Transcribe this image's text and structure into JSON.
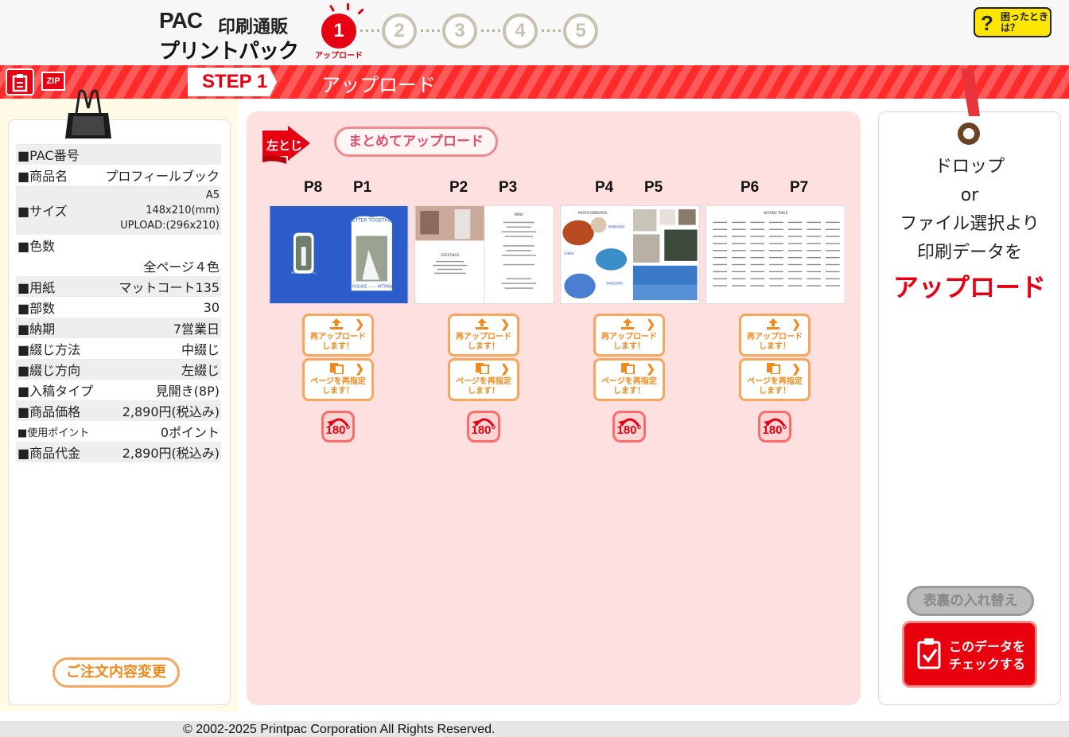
{
  "header": {
    "logo": {
      "pac": "PAC",
      "sub": "印刷通販",
      "main": "プリントパック"
    },
    "steps": [
      "1",
      "2",
      "3",
      "4",
      "5"
    ],
    "active_step_caption": "アップロード",
    "help_label": "困ったときは？",
    "help_mark": "?"
  },
  "banner": {
    "zip_label": "ZIP",
    "step_label": "STEP 1",
    "title": "アップロード"
  },
  "specs": {
    "rows": [
      {
        "label": "■PAC番号",
        "value": ""
      },
      {
        "label": "■商品名",
        "value": "プロフィールブック"
      },
      {
        "label": "■サイズ",
        "value_lines": [
          "A5",
          "148x210(mm)",
          "UPLOAD:(296x210)"
        ]
      },
      {
        "label": "■色数",
        "value": ""
      },
      {
        "label": "",
        "value": "全ページ４色"
      },
      {
        "label": "■用紙",
        "value": "マットコート135"
      },
      {
        "label": "■部数",
        "value": "30"
      },
      {
        "label": "■納期",
        "value": "7営業日"
      },
      {
        "label": "■綴じ方法",
        "value": "中綴じ"
      },
      {
        "label": "■綴じ方向",
        "value": "左綴じ"
      },
      {
        "label": "■入稿タイプ",
        "value": "見開き(8P)"
      },
      {
        "label": "■商品価格",
        "value": "2,890円(税込み)"
      },
      {
        "label": "■使用ポイント",
        "value": "0ポイント"
      },
      {
        "label": "■商品代金",
        "value": "2,890円(税込み)"
      }
    ],
    "change_order_label": "ご注文内容変更"
  },
  "center": {
    "binding_label": "左とじ",
    "bulk_upload_label": "まとめてアップロード",
    "spreads": [
      {
        "left_page": "P8",
        "right_page": "P1"
      },
      {
        "left_page": "P2",
        "right_page": "P3"
      },
      {
        "left_page": "P4",
        "right_page": "P5"
      },
      {
        "left_page": "P6",
        "right_page": "P7"
      }
    ],
    "reupload_label_1": "再アップロード",
    "reupload_label_2": "します！",
    "respecify_label_1": "ページを再指定",
    "respecify_label_2": "します！",
    "rotate_label": "180°",
    "thumb_texts": {
      "cover_title": "BETTER TOGETHER",
      "cover_names": "YUSUKE —— HITOKA",
      "cover_small": "BEST WISHES TO ALL",
      "menu": "MENU",
      "greeting": "GREETINGS",
      "photo_memories": "PHOTO MEMORIES",
      "place1": "HOKKAIDO",
      "place2": "CHIBA",
      "place3": "SHIZUOKA",
      "seating": "SEATING TABLE"
    }
  },
  "right": {
    "drop_lines": [
      "ドロップ",
      "or",
      "ファイル選択より",
      "印刷データを"
    ],
    "drop_emphasis": "アップロード",
    "swap_label": "表裏の入れ替え",
    "check_label_1": "このデータを",
    "check_label_2": "チェックする"
  },
  "footer": {
    "copyright": "© 2002-2025 Printpac Corporation All Rights Reserved."
  },
  "colors": {
    "accent": "#e60012",
    "orange": "#f08a1c",
    "panel_pink": "#ffe0e0",
    "help_yellow": "#ffe600"
  }
}
